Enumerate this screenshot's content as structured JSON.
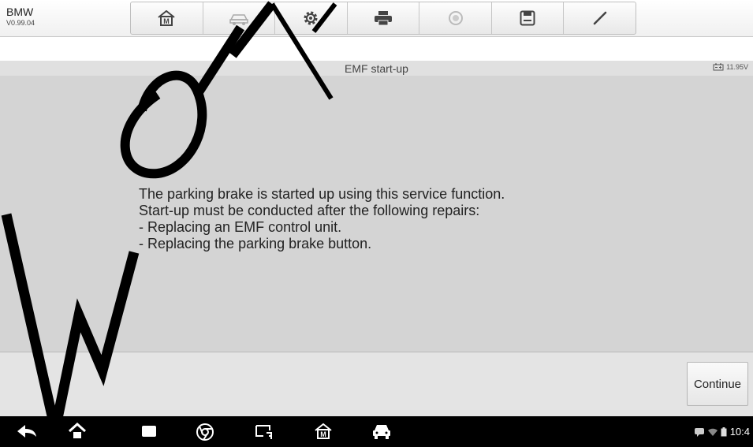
{
  "header": {
    "brand": "BMW",
    "version": "V0.99.04",
    "toolbar": [
      {
        "name": "home-m-button",
        "icon": "m-home-icon"
      },
      {
        "name": "vehicle-swap-button",
        "icon": "vehicle-icon"
      },
      {
        "name": "settings-button",
        "icon": "gear-icon"
      },
      {
        "name": "print-button",
        "icon": "printer-icon"
      },
      {
        "name": "help-button",
        "icon": "help-icon"
      },
      {
        "name": "save-button",
        "icon": "floppy-icon"
      },
      {
        "name": "edit-button",
        "icon": "pencil-icon"
      }
    ]
  },
  "titlebar": {
    "title": "EMF start-up",
    "battery_voltage": "11.95V"
  },
  "message": {
    "lines": [
      "The parking brake is started up using this service function.",
      "Start-up must be conducted after the following repairs:",
      "- Replacing an EMF control unit.",
      "- Replacing the parking brake button."
    ]
  },
  "footer": {
    "continue_label": "Continue"
  },
  "navbar": {
    "clock": "10:4"
  },
  "colors": {
    "content_bg": "#d4d4d4",
    "navbar_bg": "#000000",
    "watermark": "#000000"
  }
}
